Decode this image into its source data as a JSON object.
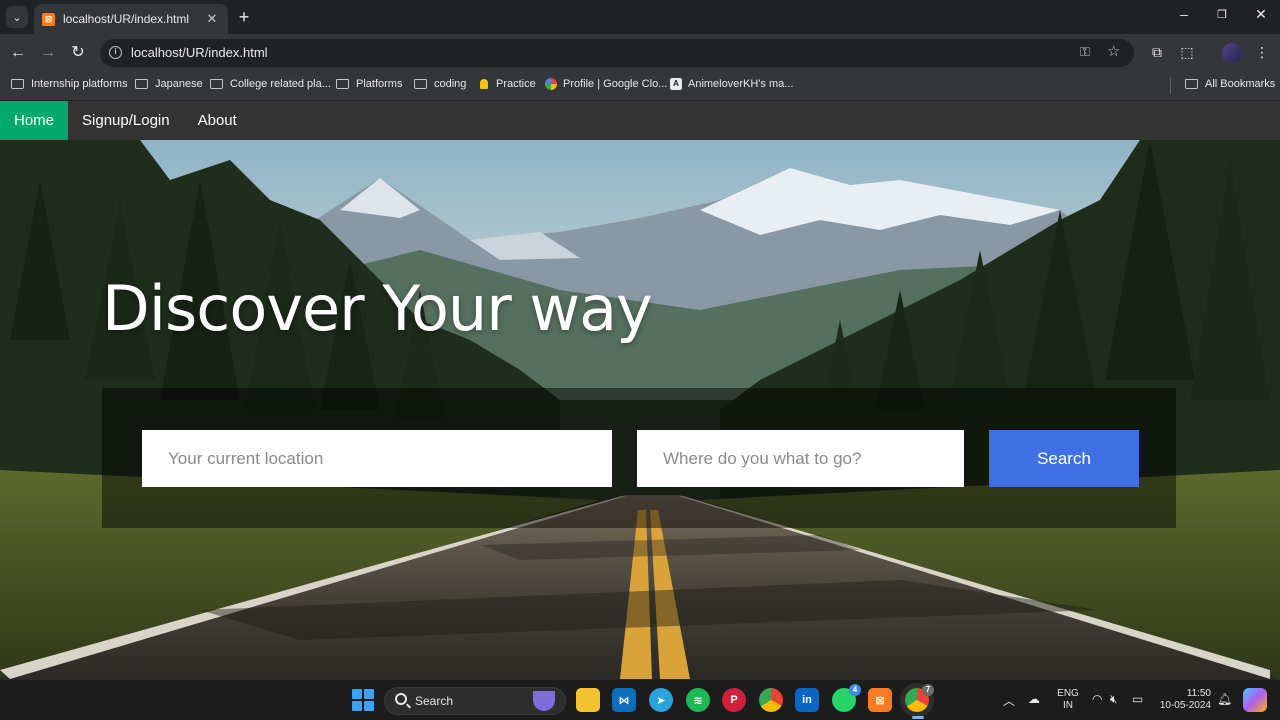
{
  "browser": {
    "tab": {
      "title": "localhost/UR/index.html",
      "favicon": "xampp-icon"
    },
    "address": {
      "url": "localhost/UR/index.html"
    },
    "bookmarks": [
      {
        "label": "Internship platforms",
        "icon": "folder-icon"
      },
      {
        "label": "Japanese",
        "icon": "folder-icon"
      },
      {
        "label": "College related pla...",
        "icon": "folder-icon"
      },
      {
        "label": "Platforms",
        "icon": "folder-icon"
      },
      {
        "label": "coding",
        "icon": "folder-icon"
      },
      {
        "label": "Practice",
        "icon": "practice-icon"
      },
      {
        "label": "Profile | Google Clo...",
        "icon": "google-cloud-icon"
      },
      {
        "label": "AnimeloverKH's ma...",
        "icon": "site-icon"
      }
    ],
    "all_bookmarks": "All Bookmarks"
  },
  "site": {
    "nav": [
      {
        "label": "Home",
        "active": true
      },
      {
        "label": "Signup/Login",
        "active": false
      },
      {
        "label": "About",
        "active": false
      }
    ],
    "hero_title": "Discover Your way",
    "search": {
      "from_placeholder": "Your current location",
      "to_placeholder": "Where do you what to go?",
      "button": "Search"
    },
    "colors": {
      "nav_active": "#04aa6d",
      "search_button": "#3f6fe0",
      "navbar": "#333333"
    }
  },
  "taskbar": {
    "search_label": "Search",
    "whatsapp_badge": "4",
    "chrome_badge": "7",
    "lang_line1": "ENG",
    "lang_line2": "IN",
    "time": "11:50",
    "date": "10-05-2024"
  }
}
